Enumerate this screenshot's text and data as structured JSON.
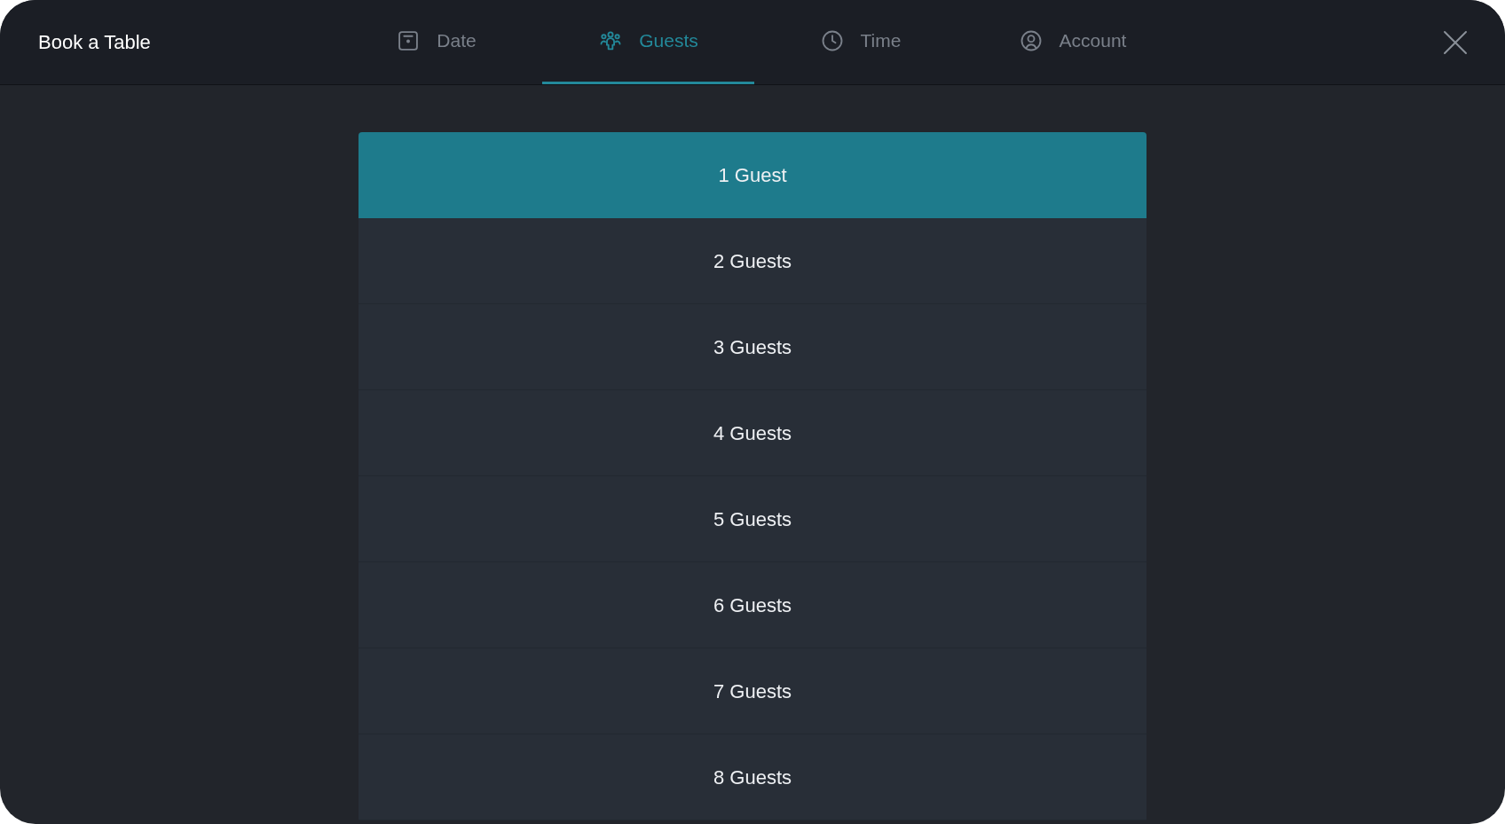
{
  "window": {
    "title": "Book a Table"
  },
  "tabs": [
    {
      "label": "Date",
      "kind": "date",
      "selected": false
    },
    {
      "label": "Guests",
      "kind": "guests",
      "selected": true
    },
    {
      "label": "Time",
      "kind": "time",
      "selected": false
    },
    {
      "label": "Account",
      "kind": "account",
      "selected": false
    }
  ],
  "options": [
    {
      "label": "1 Guest",
      "selected": true
    },
    {
      "label": "2 Guests",
      "selected": false
    },
    {
      "label": "3 Guests",
      "selected": false
    },
    {
      "label": "4 Guests",
      "selected": false
    },
    {
      "label": "5 Guests",
      "selected": false
    },
    {
      "label": "6 Guests",
      "selected": false
    },
    {
      "label": "7 Guests",
      "selected": false
    },
    {
      "label": "8 Guests",
      "selected": false
    }
  ]
}
